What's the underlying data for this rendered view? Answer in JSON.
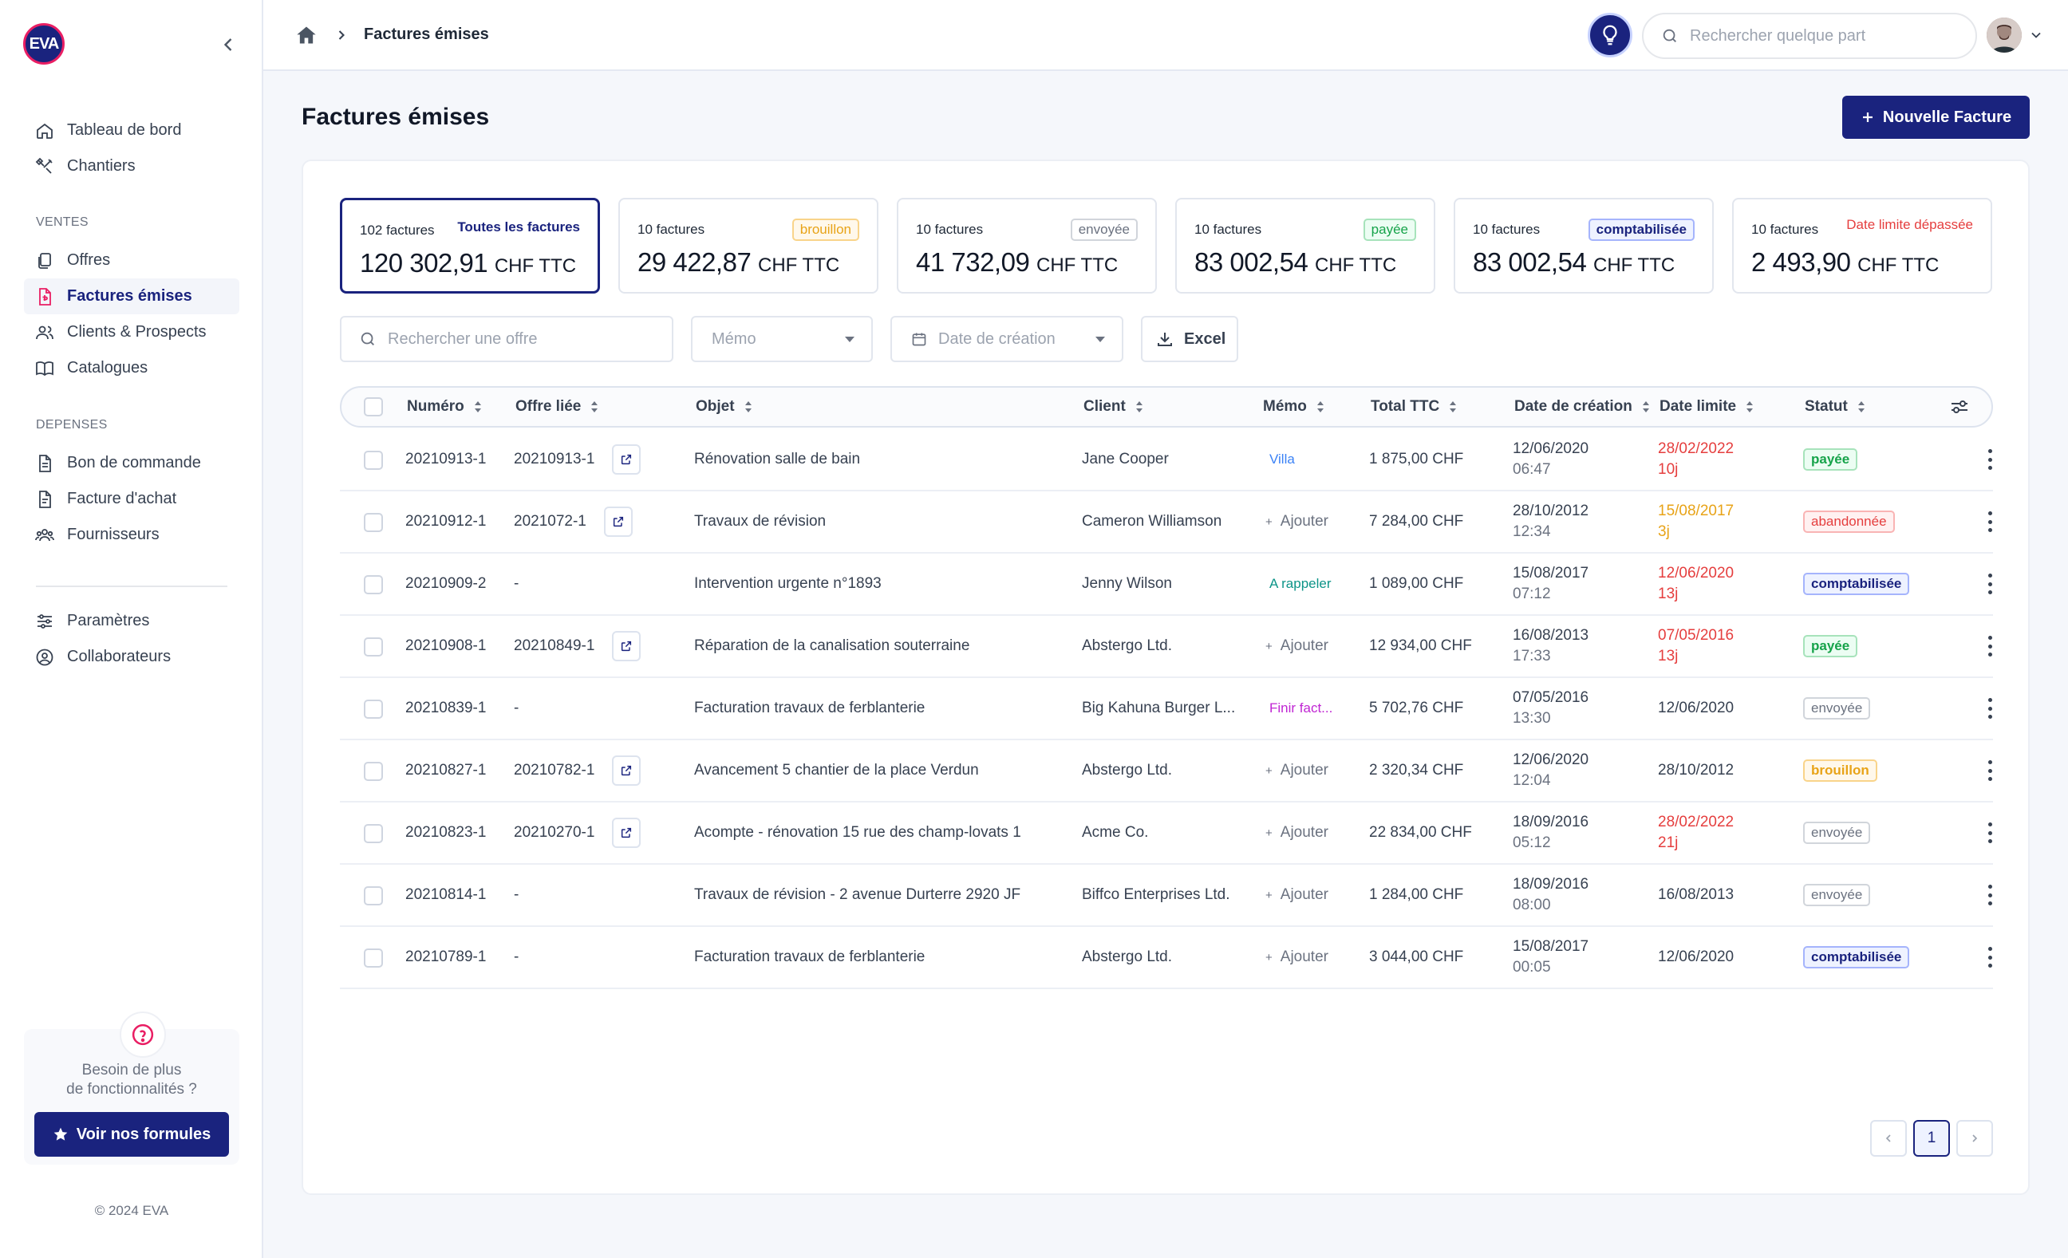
{
  "app": {
    "logo_text": "EVA"
  },
  "sidebar": {
    "main_items": [
      {
        "label": "Tableau de bord",
        "icon": "home-icon"
      },
      {
        "label": "Chantiers",
        "icon": "tools-icon"
      }
    ],
    "section_ventes": "VENTES",
    "ventes_items": [
      {
        "label": "Offres",
        "icon": "documents-icon"
      },
      {
        "label": "Factures émises",
        "icon": "invoice-icon",
        "active": true
      },
      {
        "label": "Clients & Prospects",
        "icon": "users-icon"
      },
      {
        "label": "Catalogues",
        "icon": "book-icon"
      }
    ],
    "section_depenses": "DEPENSES",
    "depenses_items": [
      {
        "label": "Bon de commande",
        "icon": "document-icon"
      },
      {
        "label": "Facture d'achat",
        "icon": "document-icon"
      },
      {
        "label": "Fournisseurs",
        "icon": "group-icon"
      }
    ],
    "bottom_items": [
      {
        "label": "Paramètres",
        "icon": "sliders-icon"
      },
      {
        "label": "Collaborateurs",
        "icon": "user-circle-icon"
      }
    ],
    "help": {
      "line1": "Besoin de plus",
      "line2": "de fonctionnalités ?",
      "button": "Voir nos formules"
    },
    "copyright": "© 2024 EVA"
  },
  "topbar": {
    "breadcrumb": "Factures émises",
    "search_placeholder": "Rechercher quelque part"
  },
  "page": {
    "title": "Factures émises",
    "new_button": "Nouvelle Facture"
  },
  "stats": [
    {
      "count": "102 factures",
      "label": "Toutes les factures",
      "amount": "120 302,91",
      "currency": "CHF TTC"
    },
    {
      "count": "10 factures",
      "label": "brouillon",
      "amount": "29 422,87",
      "currency": "CHF TTC"
    },
    {
      "count": "10 factures",
      "label": "envoyée",
      "amount": "41 732,09",
      "currency": "CHF TTC"
    },
    {
      "count": "10 factures",
      "label": "payée",
      "amount": "83 002,54",
      "currency": "CHF TTC"
    },
    {
      "count": "10 factures",
      "label": "comptabilisée",
      "amount": "83 002,54",
      "currency": "CHF TTC"
    },
    {
      "count": "10 factures",
      "label": "Date limite dépassée",
      "amount": "2 493,90",
      "currency": "CHF TTC"
    }
  ],
  "filters": {
    "search_placeholder": "Rechercher une offre",
    "memo_placeholder": "Mémo",
    "date_placeholder": "Date de création",
    "excel_label": "Excel"
  },
  "table": {
    "headers": [
      "Numéro",
      "Offre liée",
      "Objet",
      "Client",
      "Mémo",
      "Total TTC",
      "Date de création",
      "Date limite",
      "Statut"
    ],
    "rows": [
      {
        "numero": "20210913-1",
        "offre": "20210913-1",
        "objet": "Rénovation salle de bain",
        "client": "Jane Cooper",
        "memo": "Villa",
        "total": "1 875,00 CHF",
        "date": "12/06/2020",
        "time": "06:47",
        "limite": "28/02/2022",
        "limite_sub": "10j",
        "statut": "payée"
      },
      {
        "numero": "20210912-1",
        "offre": "2021072-1",
        "objet": "Travaux de révision",
        "client": "Cameron Williamson",
        "memo": "Ajouter",
        "total": "7 284,00 CHF",
        "date": "28/10/2012",
        "time": "12:34",
        "limite": "15/08/2017",
        "limite_sub": "3j",
        "statut": "abandonnée"
      },
      {
        "numero": "20210909-2",
        "offre": "-",
        "objet": "Intervention urgente n°1893",
        "client": "Jenny Wilson",
        "memo": "A rappeler",
        "total": "1 089,00 CHF",
        "date": "15/08/2017",
        "time": "07:12",
        "limite": "12/06/2020",
        "limite_sub": "13j",
        "statut": "comptabilisée"
      },
      {
        "numero": "20210908-1",
        "offre": "20210849-1",
        "objet": "Réparation de la canalisation souterraine",
        "client": "Abstergo Ltd.",
        "memo": "Ajouter",
        "total": "12 934,00 CHF",
        "date": "16/08/2013",
        "time": "17:33",
        "limite": "07/05/2016",
        "limite_sub": "13j",
        "statut": "payée"
      },
      {
        "numero": "20210839-1",
        "offre": "-",
        "objet": "Facturation travaux de ferblanterie",
        "client": "Big Kahuna Burger L...",
        "memo": "Finir fact...",
        "total": "5 702,76 CHF",
        "date": "07/05/2016",
        "time": "13:30",
        "limite": "12/06/2020",
        "limite_sub": "",
        "statut": "envoyée"
      },
      {
        "numero": "20210827-1",
        "offre": "20210782-1",
        "objet": "Avancement 5 chantier de la place Verdun",
        "client": "Abstergo Ltd.",
        "memo": "Ajouter",
        "total": "2 320,34 CHF",
        "date": "12/06/2020",
        "time": "12:04",
        "limite": "28/10/2012",
        "limite_sub": "",
        "statut": "brouillon"
      },
      {
        "numero": "20210823-1",
        "offre": "20210270-1",
        "objet": "Acompte - rénovation 15 rue des champ-lovats  1",
        "client": "Acme Co.",
        "memo": "Ajouter",
        "total": "22 834,00 CHF",
        "date": "18/09/2016",
        "time": "05:12",
        "limite": "28/02/2022",
        "limite_sub": "21j",
        "statut": "envoyée"
      },
      {
        "numero": "20210814-1",
        "offre": "-",
        "objet": "Travaux de révision - 2 avenue Durterre 2920 JF",
        "client": "Biffco Enterprises Ltd.",
        "memo": "Ajouter",
        "total": "1 284,00 CHF",
        "date": "18/09/2016",
        "time": "08:00",
        "limite": "16/08/2013",
        "limite_sub": "",
        "statut": "envoyée"
      },
      {
        "numero": "20210789-1",
        "offre": "-",
        "objet": "Facturation travaux de ferblanterie",
        "client": "Abstergo Ltd.",
        "memo": "Ajouter",
        "total": "3 044,00 CHF",
        "date": "15/08/2017",
        "time": "00:05",
        "limite": "12/06/2020",
        "limite_sub": "",
        "statut": "comptabilisée"
      }
    ]
  },
  "pagination": {
    "current": "1"
  }
}
